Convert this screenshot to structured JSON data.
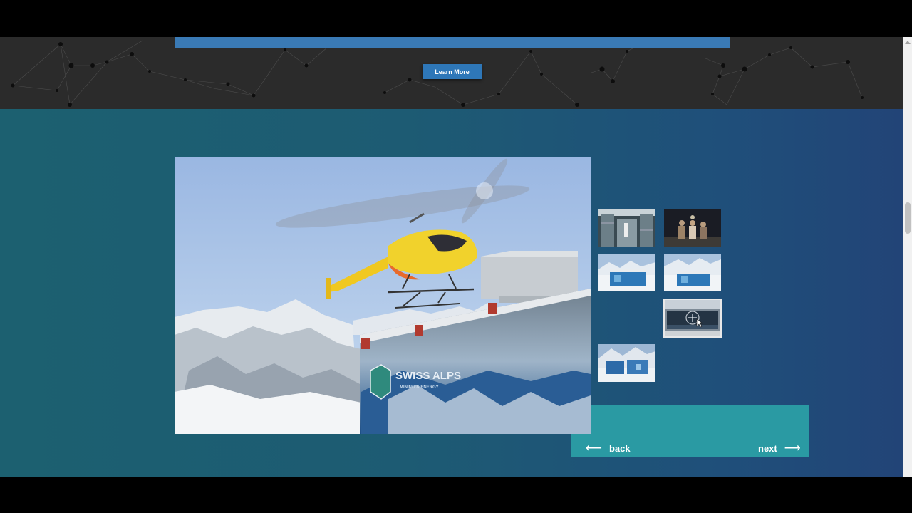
{
  "hero": {
    "learn_more_label": "Learn More"
  },
  "gallery": {
    "main_image_banner": {
      "brand": "SWISS ALPS",
      "tagline": "MINING & ENERGY"
    },
    "thumbnails": [
      {
        "subject": "server racks corridor",
        "active": false
      },
      {
        "subject": "people at night",
        "active": false
      },
      {
        "subject": "container in snow",
        "active": false
      },
      {
        "subject": "container in snow",
        "active": false
      },
      {
        "subject": "truck with container",
        "active": true
      },
      {
        "subject": "containers on mountain",
        "active": false
      }
    ],
    "nav": {
      "back_label": "back",
      "next_label": "next",
      "back_arrow": "⟵",
      "next_arrow": "⟶"
    }
  },
  "colors": {
    "accent_blue": "#2e77b8",
    "nav_teal": "#2a9aa3",
    "section_gradient_start": "#1c6070",
    "section_gradient_end": "#224477"
  }
}
